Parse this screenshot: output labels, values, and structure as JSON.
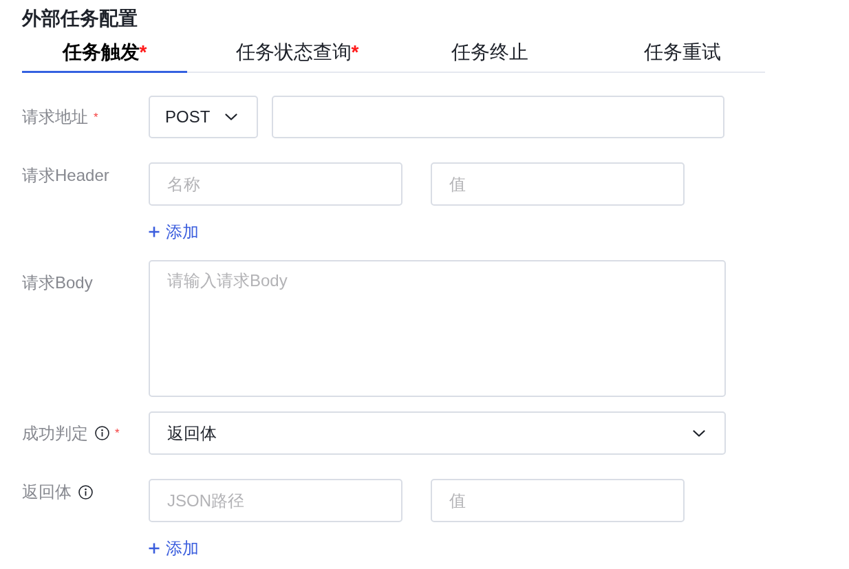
{
  "title": "外部任务配置",
  "tabs": [
    {
      "label": "任务触发",
      "required_mark": "*",
      "selected": true
    },
    {
      "label": "任务状态查询",
      "required_mark": "*",
      "selected": false
    },
    {
      "label": "任务终止",
      "selected": false
    },
    {
      "label": "任务重试",
      "selected": false
    }
  ],
  "form": {
    "rows": [
      {
        "kind": "request-url",
        "label": "请求地址",
        "required_mark": "*",
        "method": "POST"
      },
      {
        "kind": "pairs",
        "label": "请求Header",
        "pairs": [
          {
            "key_placeholder": "名称",
            "value_placeholder": "值"
          }
        ],
        "add_link": "添加"
      },
      {
        "kind": "textarea",
        "label": "请求Body",
        "placeholder": "请输入请求Body"
      },
      {
        "kind": "select",
        "label": "成功判定",
        "info": true,
        "required_mark": "*",
        "value": "返回体"
      },
      {
        "kind": "pairs",
        "label": "返回体",
        "info": true,
        "pairs": [
          {
            "key_placeholder": "JSON路径",
            "value_placeholder": "值"
          }
        ],
        "add_link": "添加"
      }
    ]
  }
}
